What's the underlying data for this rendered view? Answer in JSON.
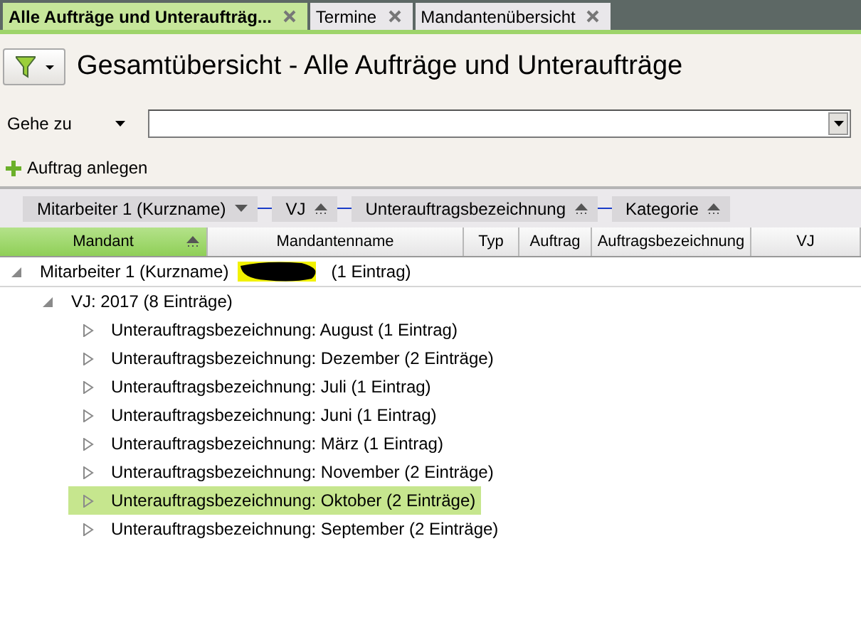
{
  "tabs": [
    {
      "label": "Alle Aufträge und Unteraufträg...",
      "selected": true
    },
    {
      "label": "Termine",
      "selected": false
    },
    {
      "label": "Mandantenübersicht",
      "selected": false
    }
  ],
  "title": "Gesamtübersicht - Alle Aufträge und Unteraufträge",
  "goto": {
    "label": "Gehe zu"
  },
  "add_action": "Auftrag anlegen",
  "group_panel": [
    {
      "label": "Mitarbeiter 1 (Kurzname)",
      "kind": "dropdown"
    },
    {
      "label": "VJ",
      "kind": "sorted"
    },
    {
      "label": "Unterauftragsbezeichnung",
      "kind": "sorted"
    },
    {
      "label": "Kategorie",
      "kind": "sorted"
    }
  ],
  "columns": [
    {
      "label": "Mandant",
      "selected": true
    },
    {
      "label": "Mandantenname",
      "selected": false
    },
    {
      "label": "Typ",
      "selected": false
    },
    {
      "label": "Auftrag",
      "selected": false
    },
    {
      "label": "Auftragsbezeichnung",
      "selected": false
    },
    {
      "label": "VJ",
      "selected": false
    }
  ],
  "tree": [
    {
      "label": "Mitarbeiter 1 (Kurzname)",
      "count": "(1 Eintrag)",
      "expanded": true,
      "selected": false,
      "children": [
        {
          "label": "VJ: 2017 (8 Einträge)",
          "expanded": true,
          "selected": false,
          "children": [
            {
              "label": "Unterauftragsbezeichnung: August (1 Eintrag)",
              "expanded": false,
              "selected": false
            },
            {
              "label": "Unterauftragsbezeichnung: Dezember (2 Einträge)",
              "expanded": false,
              "selected": false
            },
            {
              "label": "Unterauftragsbezeichnung: Juli (1 Eintrag)",
              "expanded": false,
              "selected": false
            },
            {
              "label": "Unterauftragsbezeichnung: Juni (1 Eintrag)",
              "expanded": false,
              "selected": false
            },
            {
              "label": "Unterauftragsbezeichnung: März (1 Eintrag)",
              "expanded": false,
              "selected": false
            },
            {
              "label": "Unterauftragsbezeichnung: November (2 Einträge)",
              "expanded": false,
              "selected": false
            },
            {
              "label": "Unterauftragsbezeichnung: Oktober (2 Einträge)",
              "expanded": false,
              "selected": true
            },
            {
              "label": "Unterauftragsbezeichnung: September (2 Einträge)",
              "expanded": false,
              "selected": false
            }
          ]
        }
      ]
    }
  ]
}
